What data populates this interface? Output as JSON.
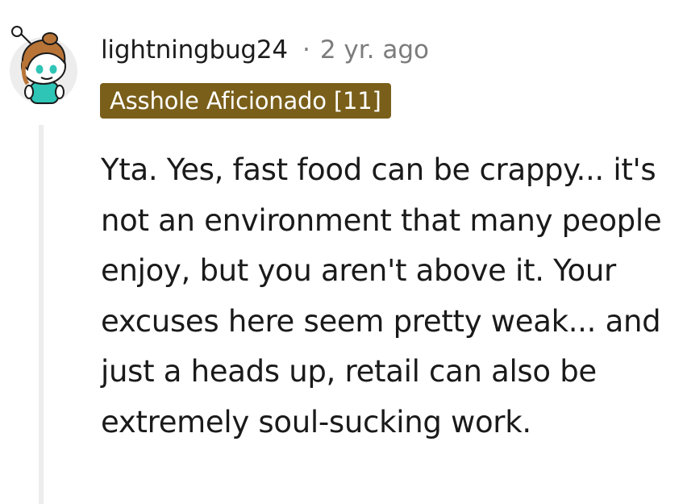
{
  "comment": {
    "author": "lightningbug24",
    "separator": "·",
    "timestamp": "2 yr. ago",
    "flair": "Asshole Aficionado [11]",
    "body": "Yta. Yes, fast food can be crappy... it's not an environment that many people enjoy, but you aren't above it. Your excuses here seem pretty weak... and just a heads up, retail can also be extremely soul-sucking work."
  },
  "avatar": {
    "icon": "snoo-avatar"
  },
  "colors": {
    "flair_background": "#7a5f1a",
    "flair_text": "#ffffff",
    "username": "#1c1c1c",
    "meta": "#7c7c7c",
    "body": "#1a1a1b",
    "thread_line": "#ededed"
  }
}
